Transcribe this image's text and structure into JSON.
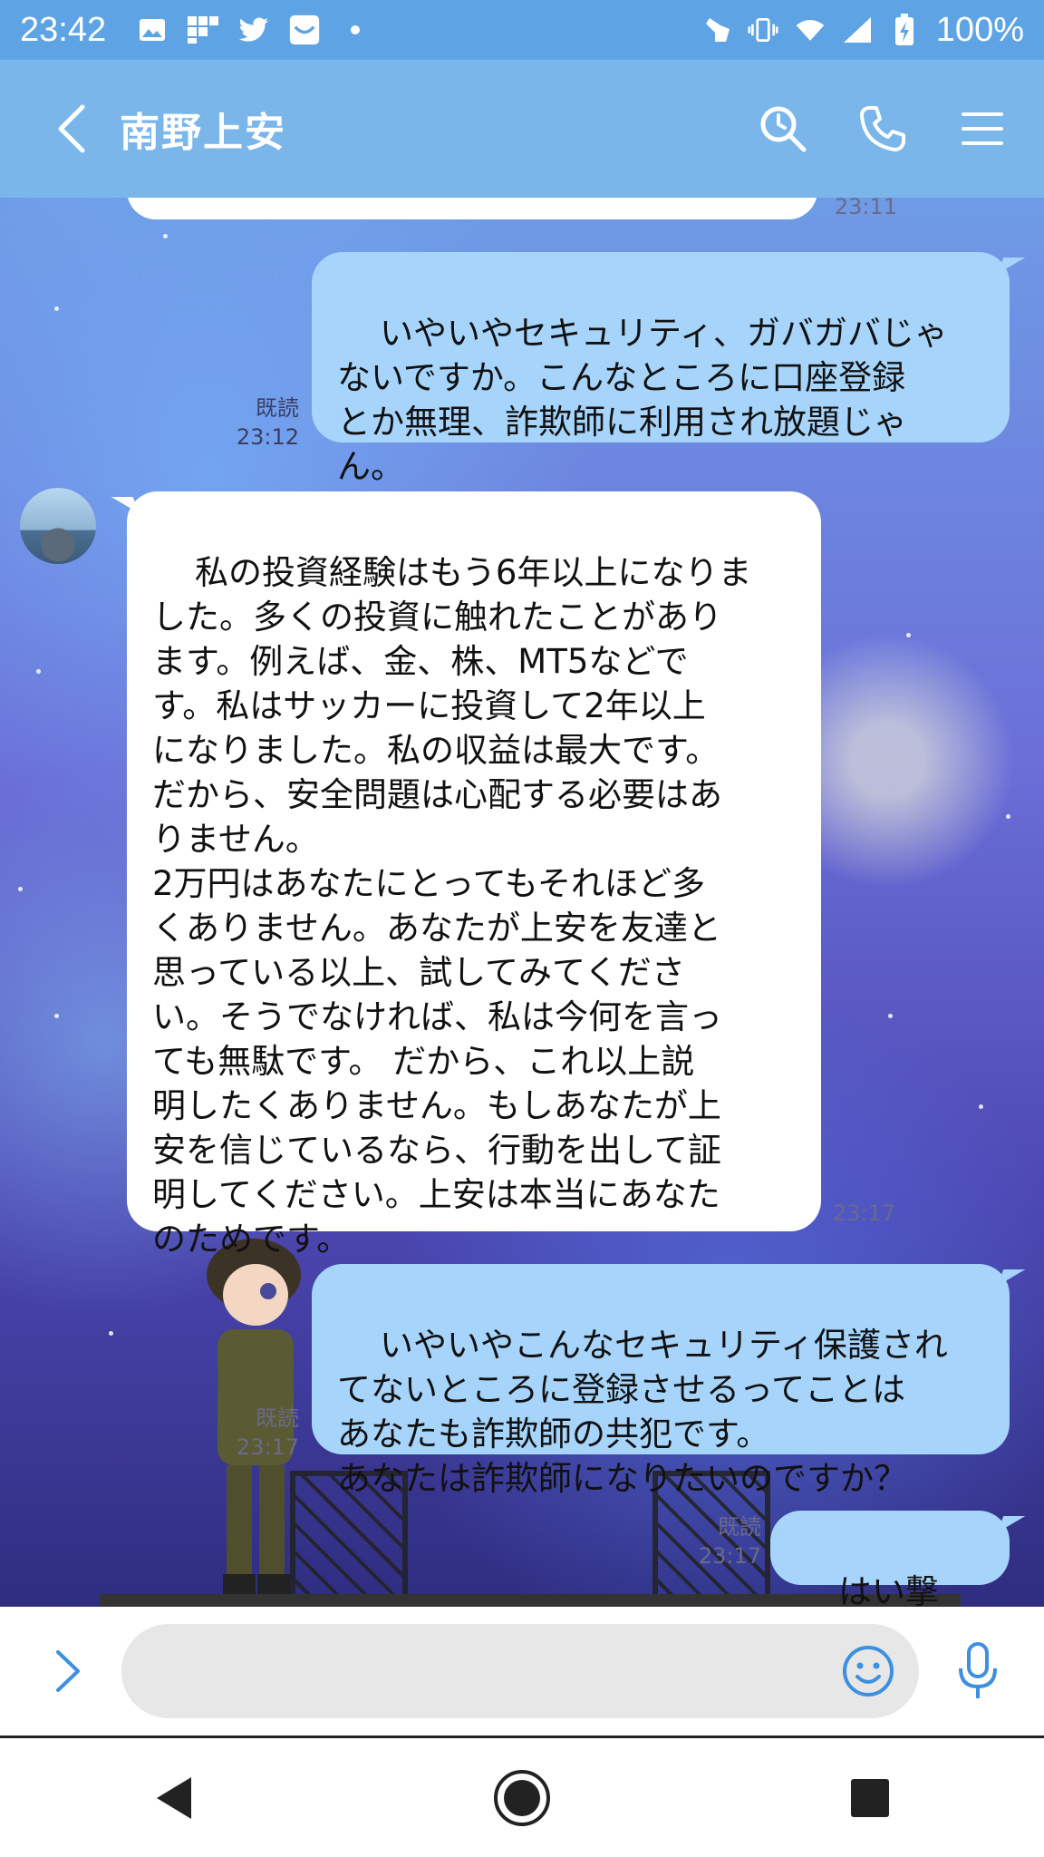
{
  "status_bar": {
    "time": "23:42",
    "battery": "100%",
    "left_icons": [
      "image-icon",
      "flipboard-icon",
      "twitter-icon",
      "inbox-icon",
      "dot-icon"
    ],
    "right_icons": [
      "gesture-icon",
      "vibrate-icon",
      "wifi-icon",
      "signal-icon",
      "battery-charging-icon"
    ]
  },
  "header": {
    "title": "南野上安",
    "back_icon": "chevron-left-icon",
    "actions": [
      "search-icon",
      "phone-icon",
      "menu-icon"
    ]
  },
  "colors": {
    "header_bg": "#7ab6ea",
    "status_bg": "#5ea4e4",
    "outgoing_bubble": "#a6d4fb",
    "incoming_bubble": "#ffffff"
  },
  "messages": [
    {
      "id": "m0",
      "direction": "in",
      "text": "",
      "time": "23:11"
    },
    {
      "id": "m1",
      "direction": "out",
      "text": "いやいやセキュリティ、ガバガバじゃ\nないですか。こんなところに口座登録\nとか無理、詐欺師に利用され放題じゃ\nん。",
      "read": "既読",
      "time": "23:12"
    },
    {
      "id": "m2",
      "direction": "in",
      "text": "私の投資経験はもう6年以上になりま\nした。多くの投資に触れたことがあり\nます。例えば、金、株、MT5などで\nす。私はサッカーに投資して2年以上\nになりました。私の収益は最大です。\nだから、安全問題は心配する必要はあ\nりません。\n2万円はあなたにとってもそれほど多\nくありません。あなたが上安を友達と\n思っている以上、試してみてくださ\nい。そうでなければ、私は今何を言っ\nても無駄です。 だから、これ以上説\n明したくありません。もしあなたが上\n安を信じているなら、行動を出して証\n明してください。上安は本当にあなた\nのためです。",
      "time": "23:17"
    },
    {
      "id": "m3",
      "direction": "out",
      "text": "いやいやこんなセキュリティ保護され\nてないところに登録させるってことは\nあなたも詐欺師の共犯です。\nあなたは詐欺師になりたいのですか？",
      "read": "既読",
      "time": "23:17"
    },
    {
      "id": "m4",
      "direction": "out",
      "text": "はい撃沈！",
      "read": "既読",
      "time": "23:17"
    }
  ],
  "input": {
    "placeholder": "",
    "expand_icon": "chevron-right-icon",
    "emoji_icon": "smiley-icon",
    "mic_icon": "microphone-icon"
  },
  "nav_bar": {
    "buttons": [
      "back-triangle-icon",
      "home-circle-icon",
      "recents-square-icon"
    ]
  }
}
